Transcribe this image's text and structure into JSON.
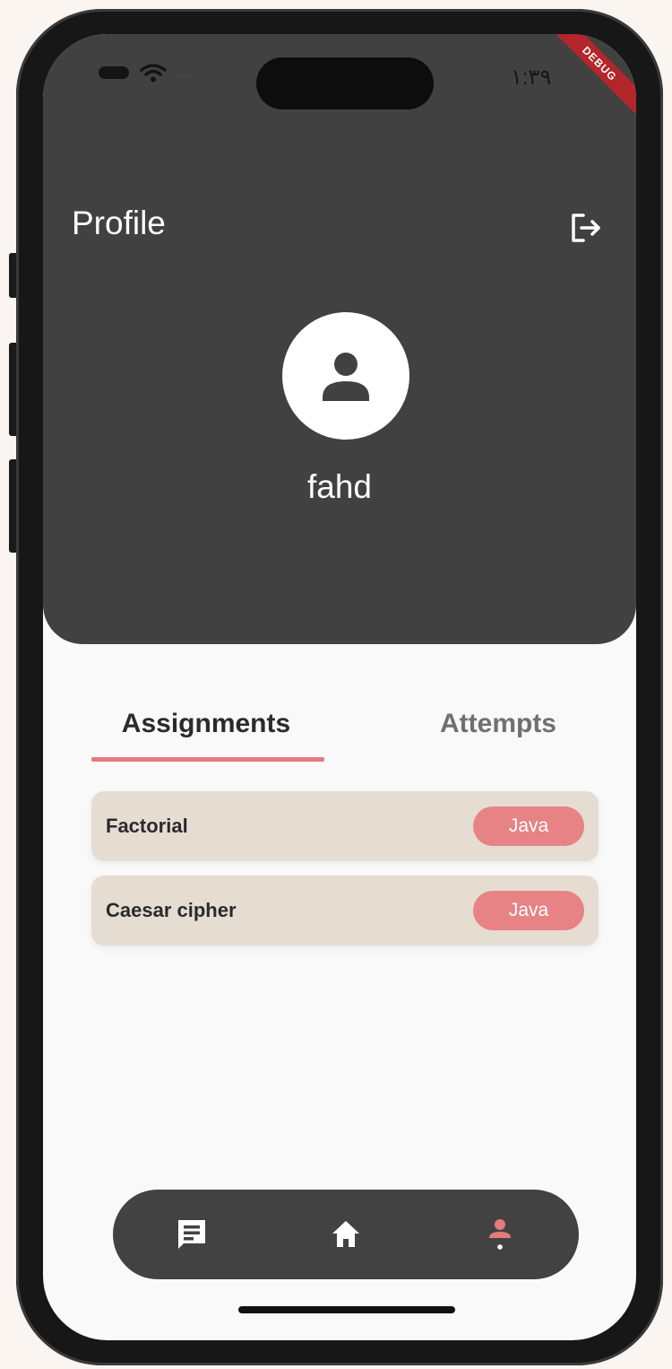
{
  "status_bar": {
    "time": "١:٣٩",
    "debug_banner": "DEBUG",
    "signal_dots": "...."
  },
  "header": {
    "title": "Profile",
    "logout_icon": "logout-icon"
  },
  "profile": {
    "avatar_icon": "person-icon",
    "username": "fahd"
  },
  "tabs": [
    {
      "label": "Assignments",
      "selected": true
    },
    {
      "label": "Attempts",
      "selected": false
    }
  ],
  "assignments": [
    {
      "title": "Factorial",
      "language": "Java"
    },
    {
      "title": "Caesar cipher",
      "language": "Java"
    }
  ],
  "bottom_nav": [
    {
      "icon": "chat-icon",
      "active": false
    },
    {
      "icon": "home-icon",
      "active": false
    },
    {
      "icon": "profile-icon",
      "active": true
    }
  ],
  "colors": {
    "header_bg": "#414141",
    "accent": "#e57b7e",
    "card_bg": "#e5ddd2",
    "nav_bg": "#424242"
  }
}
